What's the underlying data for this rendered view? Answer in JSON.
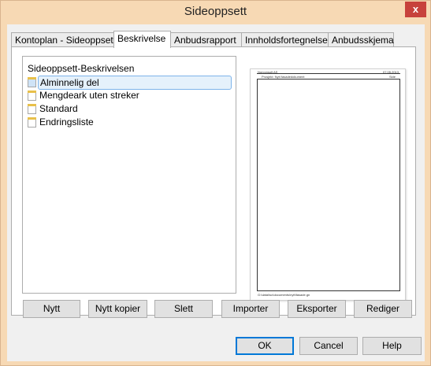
{
  "window": {
    "title": "Sideoppsett",
    "close_glyph": "x"
  },
  "tabs": [
    {
      "label": "Kontoplan - Sideoppsett"
    },
    {
      "label": "Beskrivelse"
    },
    {
      "label": "Anbudsrapport"
    },
    {
      "label": "Innholdsfortegnelse"
    },
    {
      "label": "Anbudsskjema"
    }
  ],
  "active_tab": "Beskrivelse",
  "layouts": {
    "title": "Sideoppsett-Beskrivelsen",
    "items": [
      {
        "label": "Alminnelig del",
        "selected": true
      },
      {
        "label": "Mengdeark uten streker"
      },
      {
        "label": "Standard"
      },
      {
        "label": "Endringsliste"
      }
    ]
  },
  "preview": {
    "top_left": "Norconsult AS",
    "top_right": "07.05.2013",
    "sub_left": "Prosjekt: Nytt fasadedokument",
    "sub_right": "Side",
    "footer": "G:\\data\\iso\\documents\\nytt\\fasade.gn"
  },
  "actions": {
    "new": "Nytt",
    "new_copy": "Nytt kopier",
    "delete": "Slett",
    "import": "Importer",
    "export": "Eksporter",
    "edit": "Rediger"
  },
  "dialog": {
    "ok": "OK",
    "cancel": "Cancel",
    "help": "Help"
  }
}
